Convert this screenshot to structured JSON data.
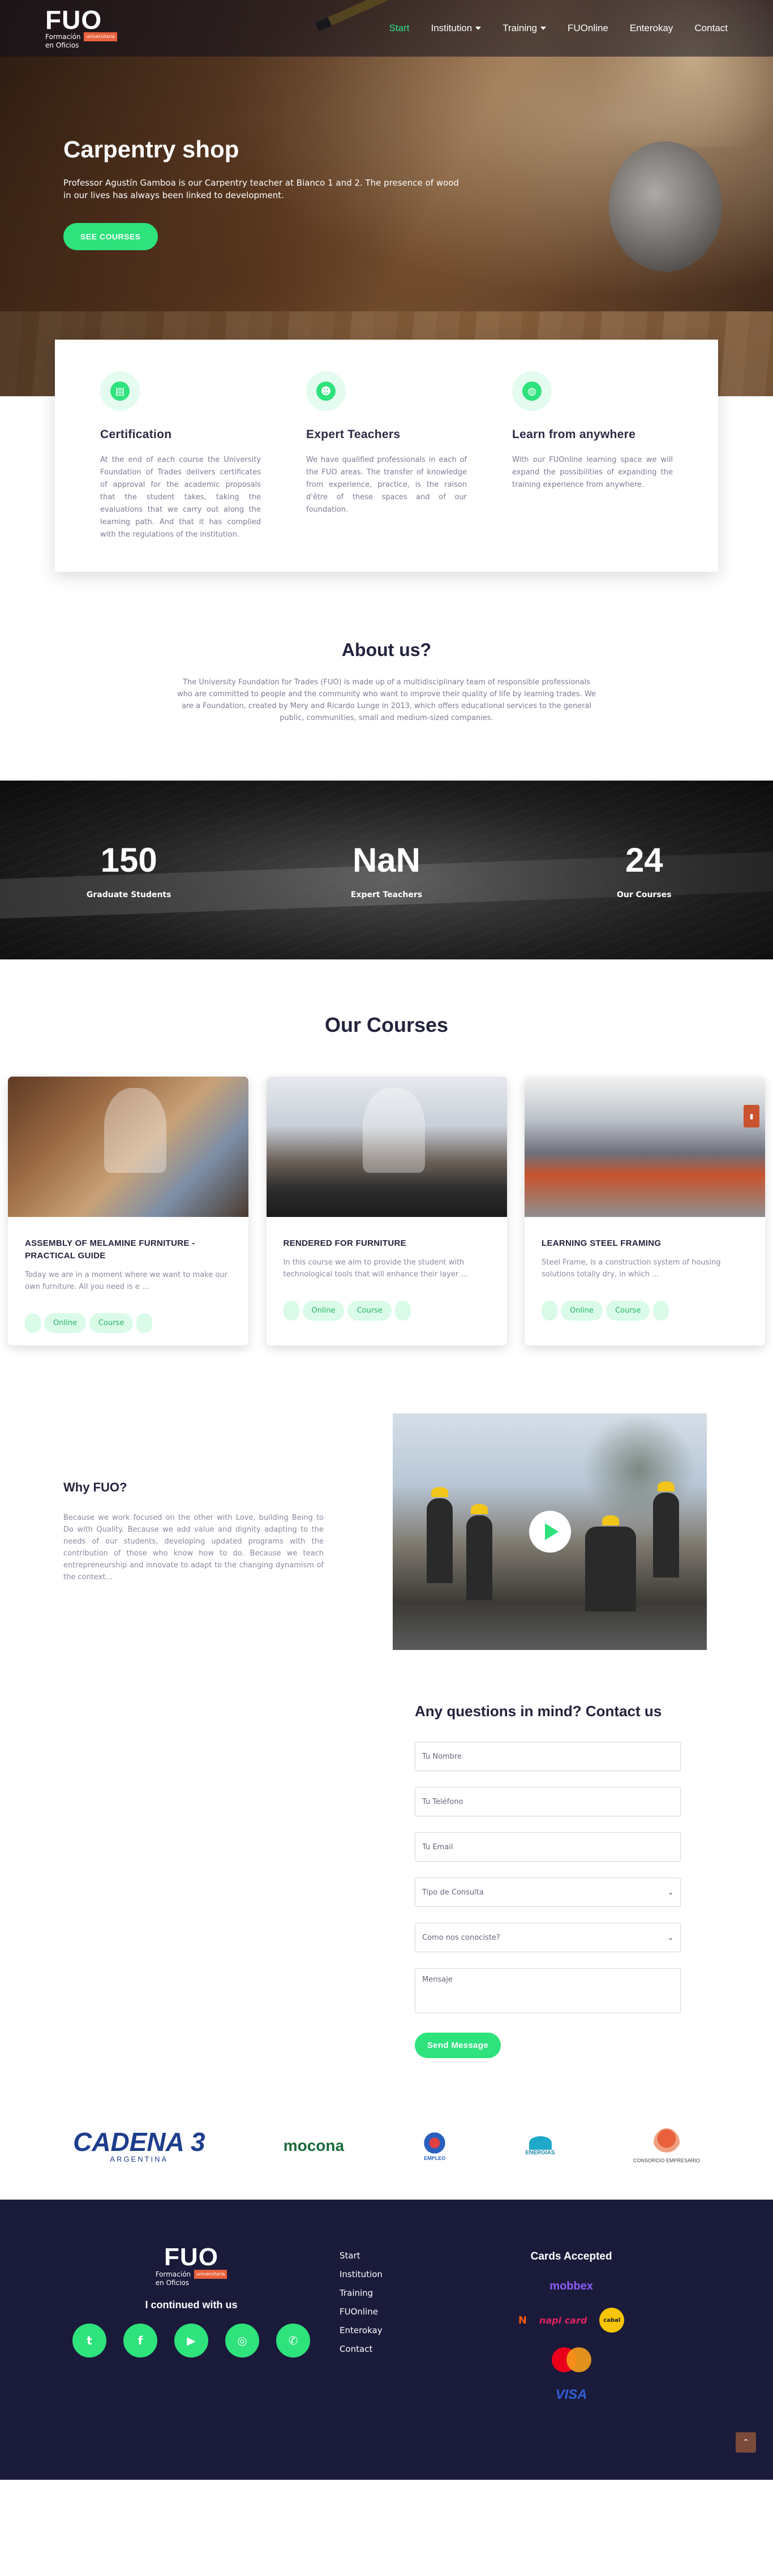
{
  "brand": {
    "logo_text": "FUO",
    "logo_sub_line1": "Formación",
    "logo_sub_line2": "en Oficios",
    "logo_tag": "universitaria",
    "accent": "#2ee27c",
    "footer_bg": "#1a1a3a"
  },
  "nav": {
    "items": [
      {
        "label": "Start",
        "active": true
      },
      {
        "label": "Institution",
        "dropdown": true
      },
      {
        "label": "Training",
        "dropdown": true
      },
      {
        "label": "FUOnline"
      },
      {
        "label": "Enterokay"
      },
      {
        "label": "Contact"
      }
    ]
  },
  "hero": {
    "title": "Carpentry shop",
    "text": "Professor Agustín Gamboa is our Carpentry teacher at Bianco 1 and 2. The presence of wood in our lives has always been linked to development.",
    "button": "SEE COURSES"
  },
  "features": [
    {
      "icon": "certificate-icon",
      "title": "Certification",
      "text": "At the end of each course the University Foundation of Trades delivers certificates of approval for the academic proposals that the student takes, taking the evaluations that we carry out along the learning path. And that it has complied with the regulations of the institution."
    },
    {
      "icon": "teachers-icon",
      "title": "Expert Teachers",
      "text": "We have qualified professionals in each of the FUO areas. The transfer of knowledge from experience, practice, is the raison d'être of these spaces and of our foundation."
    },
    {
      "icon": "globe-icon",
      "title": "Learn from anywhere",
      "text": "With our FUOnline learning space we will expand the possibilities of expanding the training experience from anywhere."
    }
  ],
  "about": {
    "title": "About us?",
    "text": "The University Foundation for Trades (FUO) is made up of a multidisciplinary team of responsible professionals who are committed to people and the community who want to improve their quality of life by learning trades. We are a Foundation, created by Mery and Ricardo Lunge in 2013, which offers educational services to the general public, communities, small and medium-sized companies."
  },
  "stats": [
    {
      "value": "150",
      "label": "Graduate Students"
    },
    {
      "value": "NaN",
      "label": "Expert Teachers"
    },
    {
      "value": "24",
      "label": "Our Courses"
    }
  ],
  "courses": {
    "title": "Our Courses",
    "items": [
      {
        "title": "ASSEMBLY OF MELAMINE FURNITURE - PRACTICAL GUIDE",
        "text": "Today we are in a moment where we want to make our own furniture. All you need is e ...",
        "tags": [
          "Online",
          "Course"
        ]
      },
      {
        "title": "RENDERED FOR FURNITURE",
        "text": "In this course we aim to provide the student with technological tools that will enhance their layer ...",
        "tags": [
          "Online",
          "Course"
        ]
      },
      {
        "title": "LEARNING STEEL FRAMING",
        "text": "Steel Frame, is a construction system of housing solutions totally dry, in which ...",
        "tags": [
          "Online",
          "Course"
        ]
      }
    ]
  },
  "why": {
    "title": "Why FUO?",
    "text": "Because we work focused on the other with Love, building Being to Do with Quality. Because we add value and dignity adapting to the needs of our students, developing updated programs with the contribution of those who know how to do. Because we teach entrepreneurship and innovate to adapt to the changing dynamism of the context..."
  },
  "contact": {
    "title": "Any questions in mind? Contact us",
    "name_placeholder": "Tu Nombre",
    "phone_placeholder": "Tu Teléfono",
    "email_placeholder": "Tu Email",
    "type_select": "Tipo de Consulta",
    "how_select": "Como nos conociste?",
    "message_placeholder": "Mensaje",
    "send": "Send Message"
  },
  "partners": {
    "cadena": "CADENA 3",
    "cadena_sub": "ARGENTINA",
    "mocona": "mocona",
    "empleo": "EMPLEO",
    "energias": "ENERGÍAS",
    "consorcio": "CONSORCIO EMPRESARIO"
  },
  "footer": {
    "social_title": "I continued with us",
    "links": [
      "Start",
      "Institution",
      "Training",
      "FUOnline",
      "Enterokay",
      "Contact"
    ],
    "cards_title": "Cards Accepted",
    "cards": {
      "mobbex": "mobbex",
      "naranja": "N",
      "napi": "napi card",
      "cabal": "cabal",
      "visa": "VISA"
    }
  }
}
